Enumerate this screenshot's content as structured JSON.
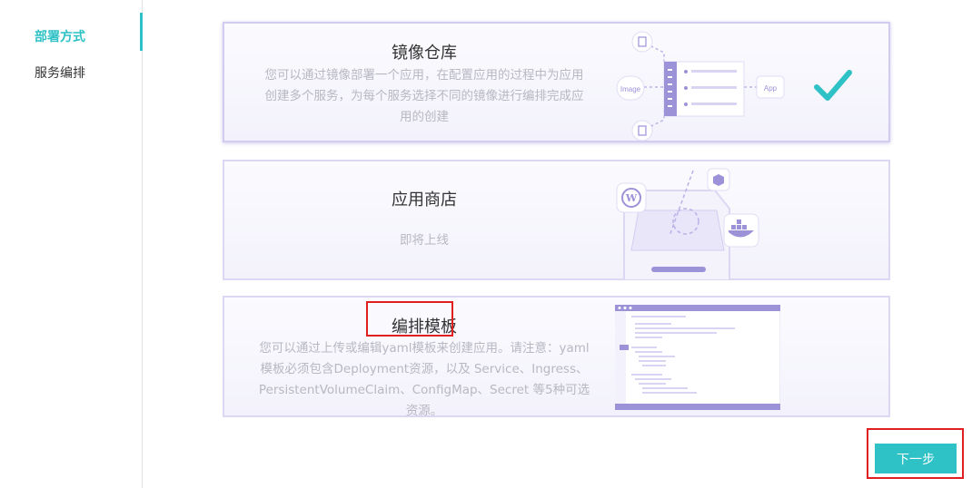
{
  "sidebar": {
    "items": [
      {
        "label": "部署方式",
        "active": true
      },
      {
        "label": "服务编排",
        "active": false
      }
    ]
  },
  "cards": [
    {
      "title": "镜像仓库",
      "desc_lines": [
        "您可以通过镜像部署一个应用，在配置应用的过程中为应用",
        "创建多个服务，为每个服务选择不同的镜像进行编排完成应",
        "用的创建"
      ],
      "selected": true,
      "diagram": {
        "image_label": "Image",
        "app_label": "App"
      }
    },
    {
      "title": "应用商店",
      "desc_lines": [
        "即将上线"
      ],
      "selected": false
    },
    {
      "title": "编排模板",
      "desc_lines": [
        "您可以通过上传或编辑yaml模板来创建应用。请注意：yaml",
        "模板必须包含Deployment资源，以及 Service、Ingress、",
        "PersistentVolumeClaim、ConfigMap、Secret 等5种可选",
        "资源。"
      ],
      "selected": false
    }
  ],
  "footer": {
    "next_label": "下一步"
  },
  "colors": {
    "accent": "#2ec1c6",
    "highlight": "#e02020",
    "illustration": "#9b92d8"
  }
}
